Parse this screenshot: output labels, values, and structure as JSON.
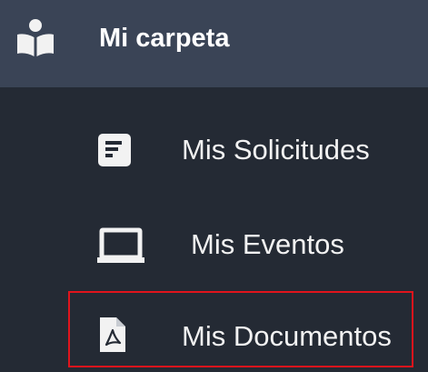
{
  "header": {
    "title": "Mi carpeta",
    "icon": "reading-user-icon"
  },
  "menu": {
    "items": [
      {
        "label": "Mis Solicitudes",
        "icon": "list-document-icon"
      },
      {
        "label": "Mis Eventos",
        "icon": "monitor-icon"
      },
      {
        "label": "Mis Documentos",
        "icon": "pdf-file-icon",
        "highlighted": true
      }
    ]
  },
  "colors": {
    "header_bg": "#3a4456",
    "sidebar_bg": "#242a34",
    "text": "#f2f2f2",
    "highlight_border": "#e0141c"
  }
}
